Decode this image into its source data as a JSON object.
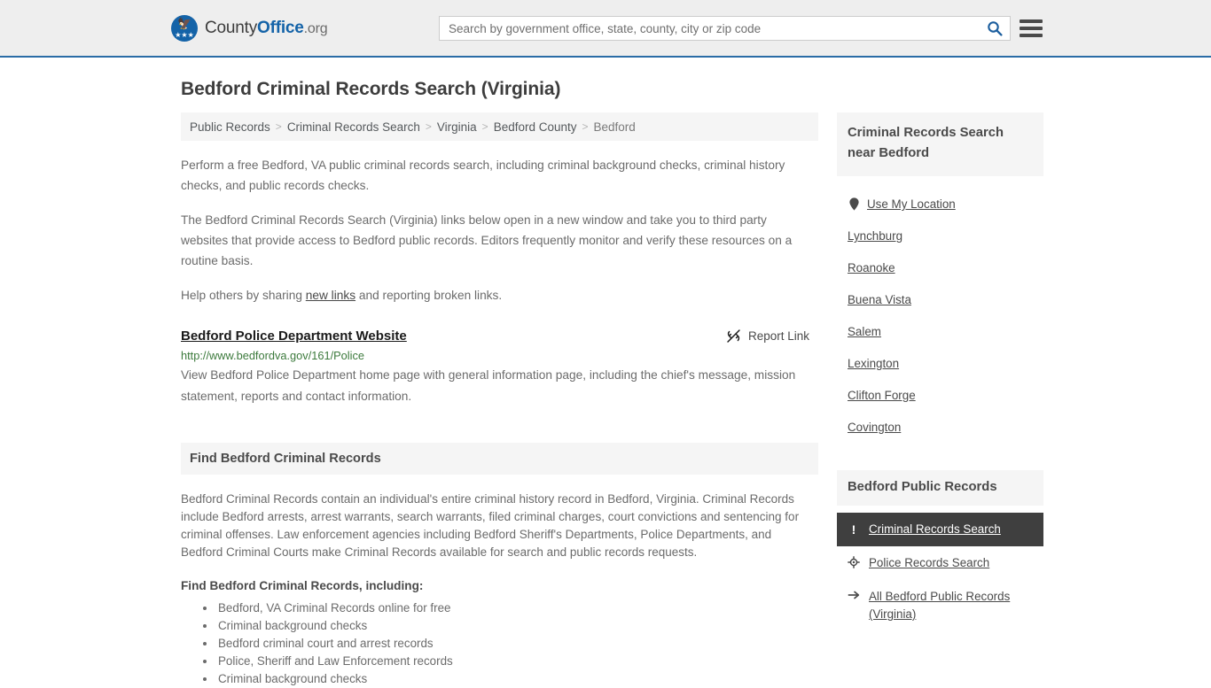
{
  "header": {
    "brand": {
      "part1": "County",
      "part2": "Office",
      "part3": ".org",
      "seal_icon": "eagle-seal-icon"
    },
    "search": {
      "placeholder": "Search by government office, state, county, city or zip code",
      "value": "",
      "icon": "search-icon"
    },
    "menu_icon": "hamburger-menu-icon",
    "accent_color": "#2a6ca6",
    "background_color": "#eeeeee"
  },
  "page": {
    "title": "Bedford Criminal Records Search (Virginia)",
    "breadcrumb": [
      "Public Records",
      "Criminal Records Search",
      "Virginia",
      "Bedford County",
      "Bedford"
    ],
    "breadcrumb_separator": ">",
    "paragraphs": {
      "p1": "Perform a free Bedford, VA public criminal records search, including criminal background checks, criminal history checks, and public records checks.",
      "p2": "The Bedford Criminal Records Search (Virginia) links below open in a new window and take you to third party websites that provide access to Bedford public records. Editors frequently monitor and verify these resources on a routine basis.",
      "p3_before": "Help others by sharing ",
      "p3_link": "new links",
      "p3_after": " and reporting broken links."
    }
  },
  "link_entry": {
    "title": "Bedford Police Department Website",
    "url": "http://www.bedfordva.gov/161/Police",
    "description": "View Bedford Police Department home page with general information page, including the chief's message, mission statement, reports and contact information.",
    "report_label": "Report Link",
    "report_icon": "broken-link-icon",
    "url_color": "#3c7a3c"
  },
  "section": {
    "heading": "Find Bedford Criminal Records",
    "paragraph": "Bedford Criminal Records contain an individual's entire criminal history record in Bedford, Virginia. Criminal Records include Bedford arrests, arrest warrants, search warrants, filed criminal charges, court convictions and sentencing for criminal offenses. Law enforcement agencies including Bedford Sheriff's Departments, Police Departments, and Bedford Criminal Courts make Criminal Records available for search and public records requests.",
    "sub_heading": "Find Bedford Criminal Records, including:",
    "bullets": [
      "Bedford, VA Criminal Records online for free",
      "Criminal background checks",
      "Bedford criminal court and arrest records",
      "Police, Sheriff and Law Enforcement records",
      "Criminal background checks"
    ]
  },
  "sidebar": {
    "nearby": {
      "heading": "Criminal Records Search near Bedford",
      "use_my_location": {
        "label": "Use My Location",
        "icon": "map-pin-icon"
      },
      "cities": [
        "Lynchburg",
        "Roanoke",
        "Buena Vista",
        "Salem",
        "Lexington",
        "Clifton Forge",
        "Covington"
      ]
    },
    "public_records": {
      "heading": "Bedford Public Records",
      "items": [
        {
          "label": "Criminal Records Search",
          "icon": "exclamation-icon",
          "active": true
        },
        {
          "label": "Police Records Search",
          "icon": "crosshair-icon",
          "active": false
        },
        {
          "label": "All Bedford Public Records (Virginia)",
          "icon": "arrow-right-icon",
          "active": false
        }
      ],
      "active_background": "#3f3f3f"
    }
  }
}
